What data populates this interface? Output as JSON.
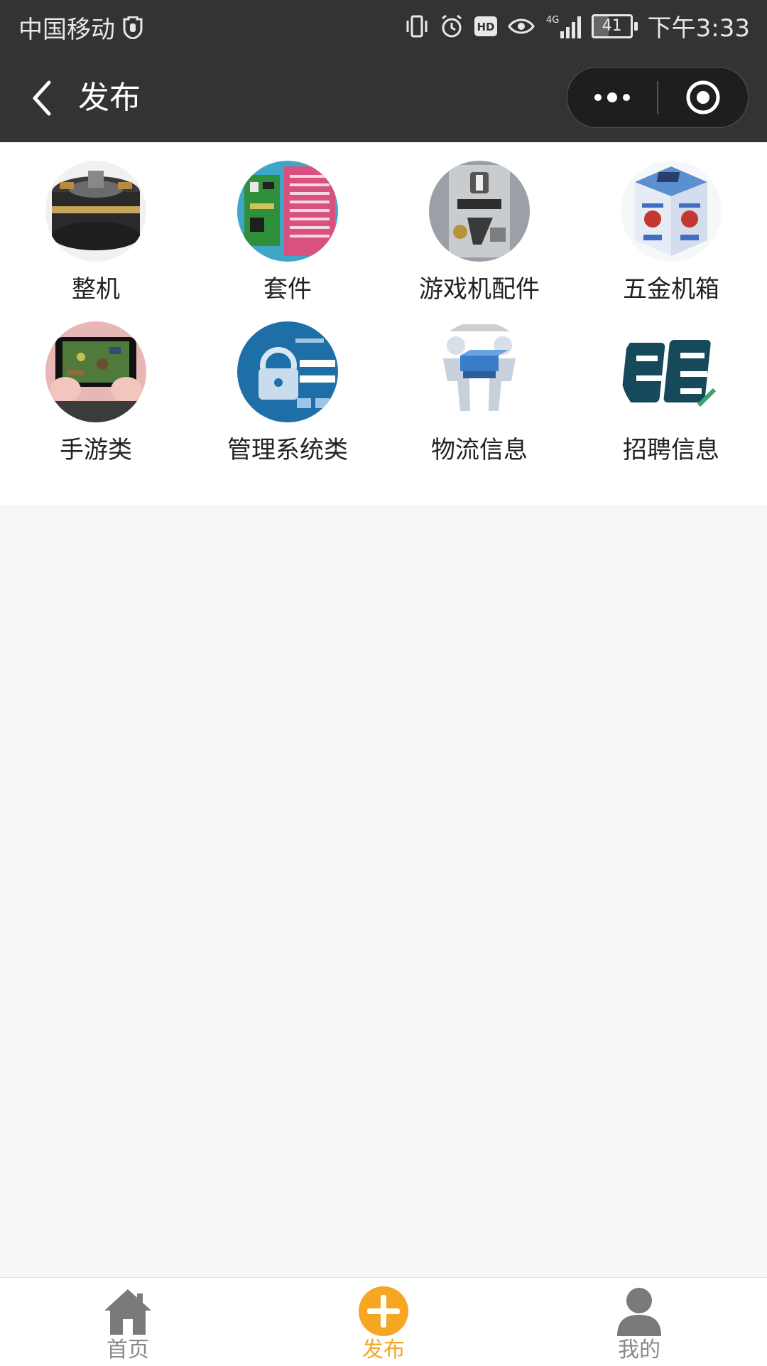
{
  "status_bar": {
    "carrier": "中国移动",
    "network": "4G",
    "battery": "41",
    "time": "下午3:33"
  },
  "nav": {
    "title": "发布"
  },
  "categories": [
    {
      "label": "整机"
    },
    {
      "label": "套件"
    },
    {
      "label": "游戏机配件"
    },
    {
      "label": "五金机箱"
    },
    {
      "label": "手游类"
    },
    {
      "label": "管理系统类"
    },
    {
      "label": "物流信息"
    },
    {
      "label": "招聘信息"
    }
  ],
  "tabs": [
    {
      "label": "首页",
      "icon": "home-icon"
    },
    {
      "label": "发布",
      "icon": "plus-circle-icon",
      "active": true
    },
    {
      "label": "我的",
      "icon": "user-icon"
    }
  ],
  "colors": {
    "header_bg": "#333333",
    "accent": "#f5a623",
    "tab_inactive": "#888888",
    "page_bg": "#f7f7f9"
  }
}
